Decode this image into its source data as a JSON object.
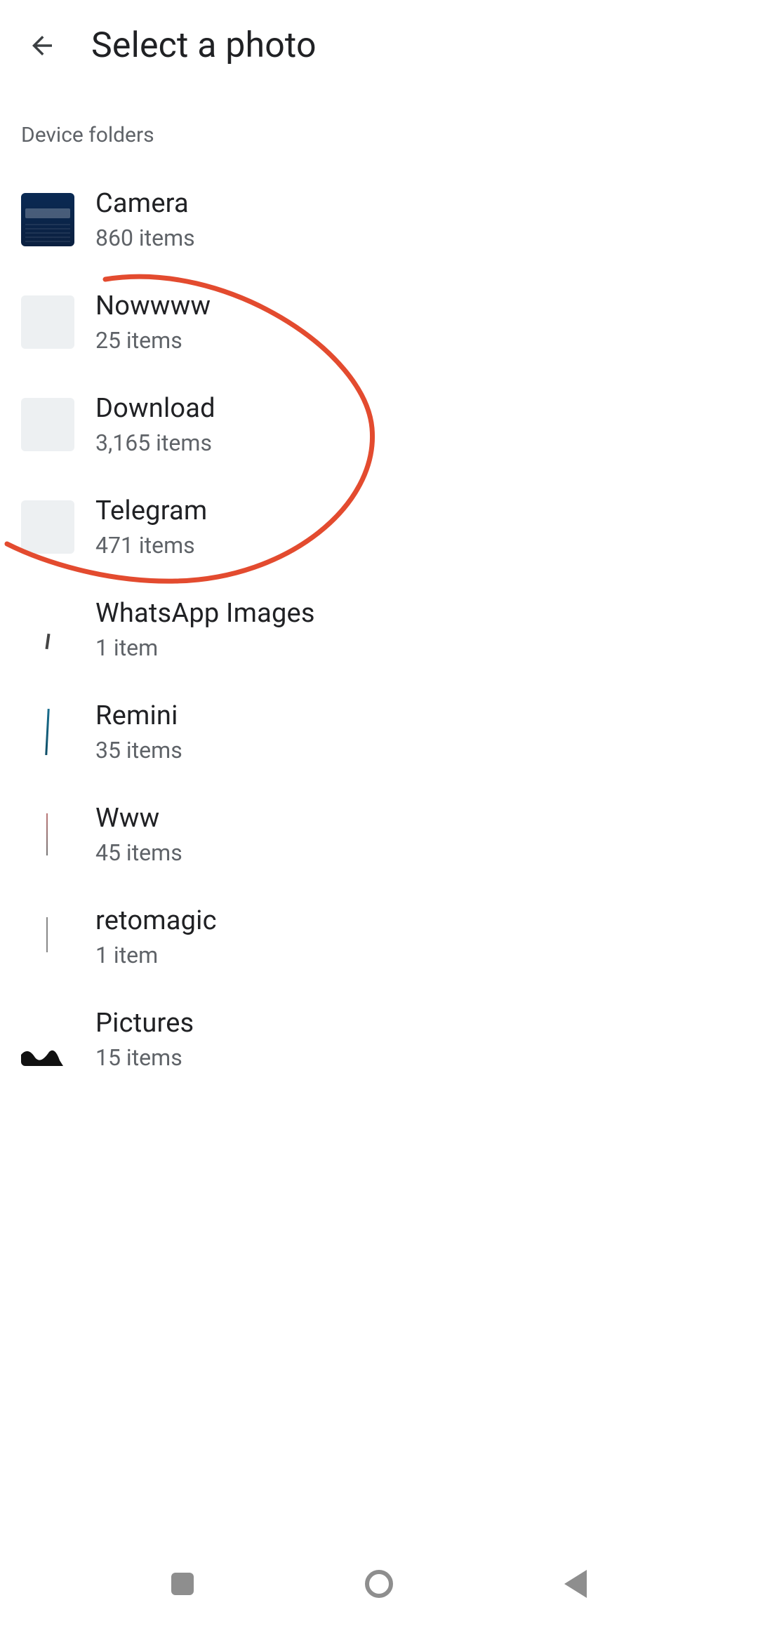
{
  "header": {
    "title": "Select a photo"
  },
  "section_label": "Device folders",
  "folders": [
    {
      "name": "Camera",
      "count": "860 items"
    },
    {
      "name": "Nowwww",
      "count": "25 items"
    },
    {
      "name": "Download",
      "count": "3,165 items"
    },
    {
      "name": "Telegram",
      "count": "471 items"
    },
    {
      "name": "WhatsApp Images",
      "count": "1 item"
    },
    {
      "name": "Remini",
      "count": "35 items"
    },
    {
      "name": "Www",
      "count": "45 items"
    },
    {
      "name": "retomagic",
      "count": "1 item"
    },
    {
      "name": "Pictures",
      "count": "15 items"
    }
  ],
  "annotation": {
    "color": "#e34b2f"
  }
}
